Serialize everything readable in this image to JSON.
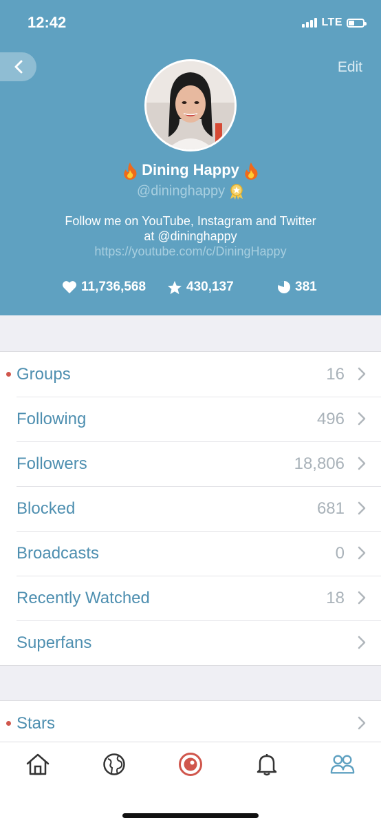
{
  "status_bar": {
    "time": "12:42",
    "network": "LTE"
  },
  "header": {
    "edit_label": "Edit",
    "display_name": "Dining Happy",
    "username": "@dininghappy",
    "bio_text": "Follow me on YouTube, Instagram and Twitter at @dininghappy ",
    "bio_link": "https://youtube.com/c/DiningHappy"
  },
  "stats": {
    "hearts": "11,736,568",
    "stars": "430,137",
    "broadcasts": "381"
  },
  "menu": [
    {
      "label": "Groups",
      "count": "16",
      "dot": true
    },
    {
      "label": "Following",
      "count": "496",
      "dot": false
    },
    {
      "label": "Followers",
      "count": "18,806",
      "dot": false
    },
    {
      "label": "Blocked",
      "count": "681",
      "dot": false
    },
    {
      "label": "Broadcasts",
      "count": "0",
      "dot": false
    },
    {
      "label": "Recently Watched",
      "count": "18",
      "dot": false
    },
    {
      "label": "Superfans",
      "count": "",
      "dot": false
    }
  ],
  "menu2": [
    {
      "label": "Stars",
      "count": "",
      "dot": true
    }
  ],
  "tabs": [
    "home-icon",
    "globe-icon",
    "camera-live-icon",
    "bell-icon",
    "people-icon"
  ],
  "colors": {
    "header_bg": "#5fa1c1",
    "accent": "#4e8fb0",
    "live_red": "#d0564c",
    "notification_dot": "#d0564c"
  }
}
